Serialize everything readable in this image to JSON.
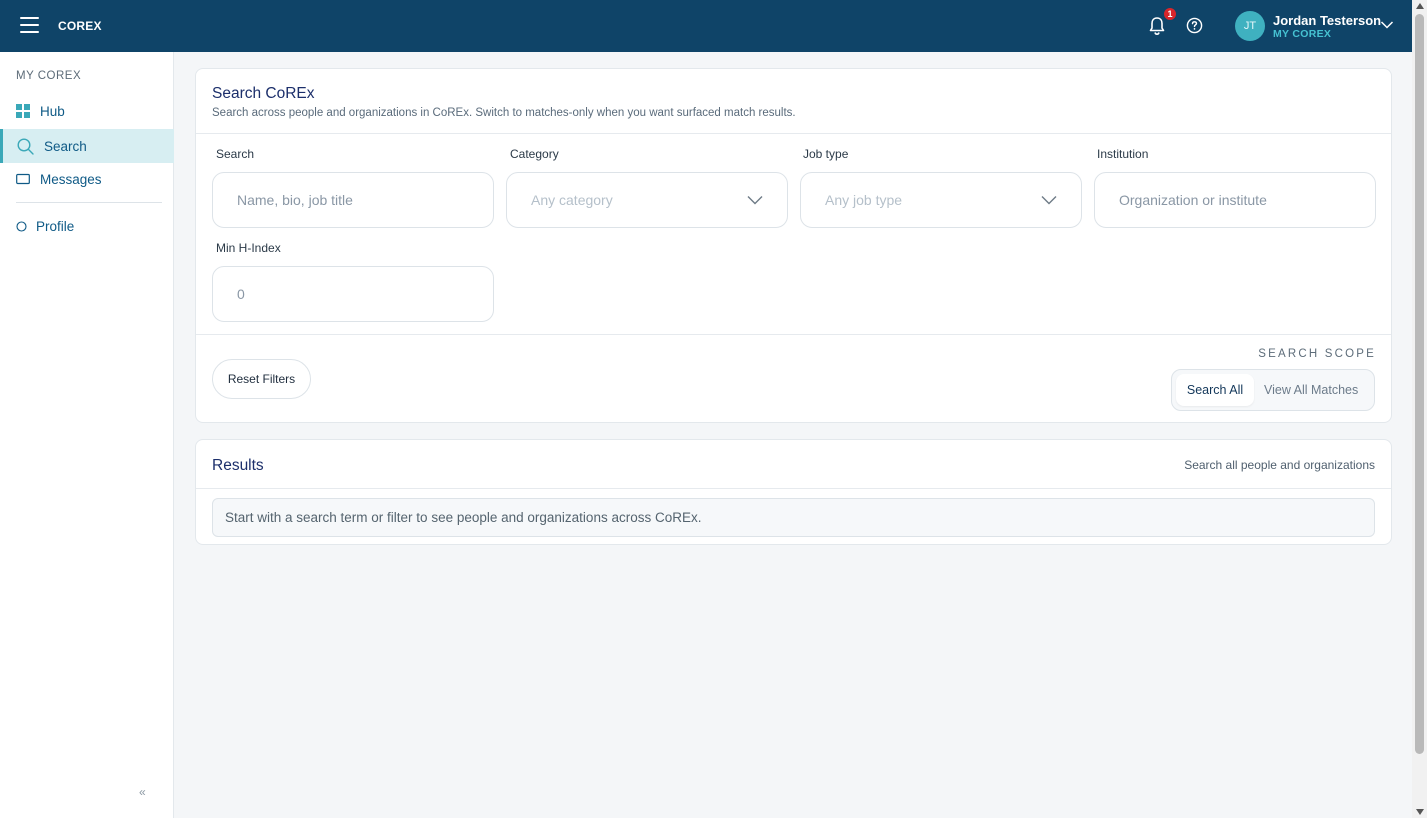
{
  "header": {
    "brand": "COREX",
    "notification_count": "1",
    "user_initials": "JT",
    "user_name": "Jordan Testerson",
    "user_context": "MY COREX"
  },
  "sidebar": {
    "heading": "MY COREX",
    "items": [
      {
        "label": "Hub",
        "icon": "grid-icon"
      },
      {
        "label": "Search",
        "icon": "search-icon",
        "active": true
      },
      {
        "label": "Messages",
        "icon": "message-icon"
      },
      {
        "label": "Profile",
        "icon": "circle-icon"
      }
    ],
    "collapse_glyph": "«"
  },
  "search_card": {
    "title": "Search CoREx",
    "subtitle": "Search across people and organizations in CoREx. Switch to matches-only when you want surfaced match results.",
    "fields": {
      "search": {
        "label": "Search",
        "placeholder": "Name, bio, job title"
      },
      "category": {
        "label": "Category",
        "placeholder": "Any category"
      },
      "job_type": {
        "label": "Job type",
        "placeholder": "Any job type"
      },
      "institution": {
        "label": "Institution",
        "placeholder": "Organization or institute"
      },
      "min_h_index": {
        "label": "Min H-Index",
        "placeholder": "0"
      }
    },
    "reset_label": "Reset Filters",
    "scope_label": "SEARCH SCOPE",
    "scope_options": [
      "Search All",
      "View All Matches"
    ],
    "scope_selected": "Search All"
  },
  "results_card": {
    "title": "Results",
    "subtitle": "Search all people and organizations",
    "empty_message": "Start with a search term or filter to see people and organizations across CoREx."
  },
  "colors": {
    "topbar": "#0f4468",
    "accent": "#3aa8b8",
    "badge": "#d8262b",
    "title": "#1c2f6b"
  }
}
